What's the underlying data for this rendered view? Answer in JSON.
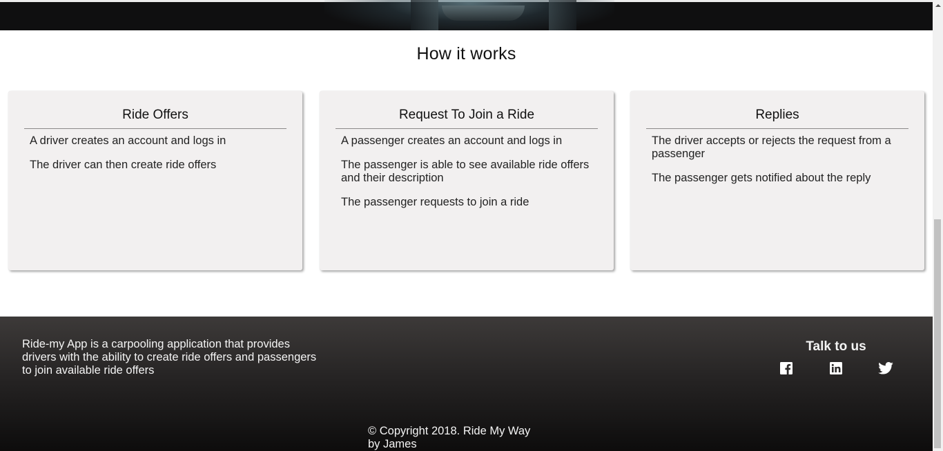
{
  "how_it_works": {
    "title": "How it works",
    "cards": [
      {
        "title": "Ride Offers",
        "items": [
          "A driver creates an account and logs in",
          "The driver can then create ride offers"
        ]
      },
      {
        "title": "Request To Join a Ride",
        "items": [
          "A passenger creates an account and logs in",
          "The passenger is able to see available ride offers and their description",
          "The passenger requests to join a ride"
        ]
      },
      {
        "title": "Replies",
        "items": [
          "The driver accepts or rejects the request from a passenger",
          "The passenger gets notified about the reply"
        ]
      }
    ]
  },
  "footer": {
    "about": "Ride-my App is a carpooling application that provides drivers with the ability to create ride offers and passengers to join available ride offers",
    "talk_title": "Talk to us",
    "social_icons": [
      "facebook-icon",
      "linkedin-icon",
      "twitter-icon"
    ],
    "copyright_line1": "© Copyright 2018. Ride My Way",
    "copyright_line2": "by James"
  },
  "colors": {
    "card_bg": "#f2f0f0",
    "footer_top": "#3d3a39",
    "footer_bottom": "#0d0c0c"
  }
}
